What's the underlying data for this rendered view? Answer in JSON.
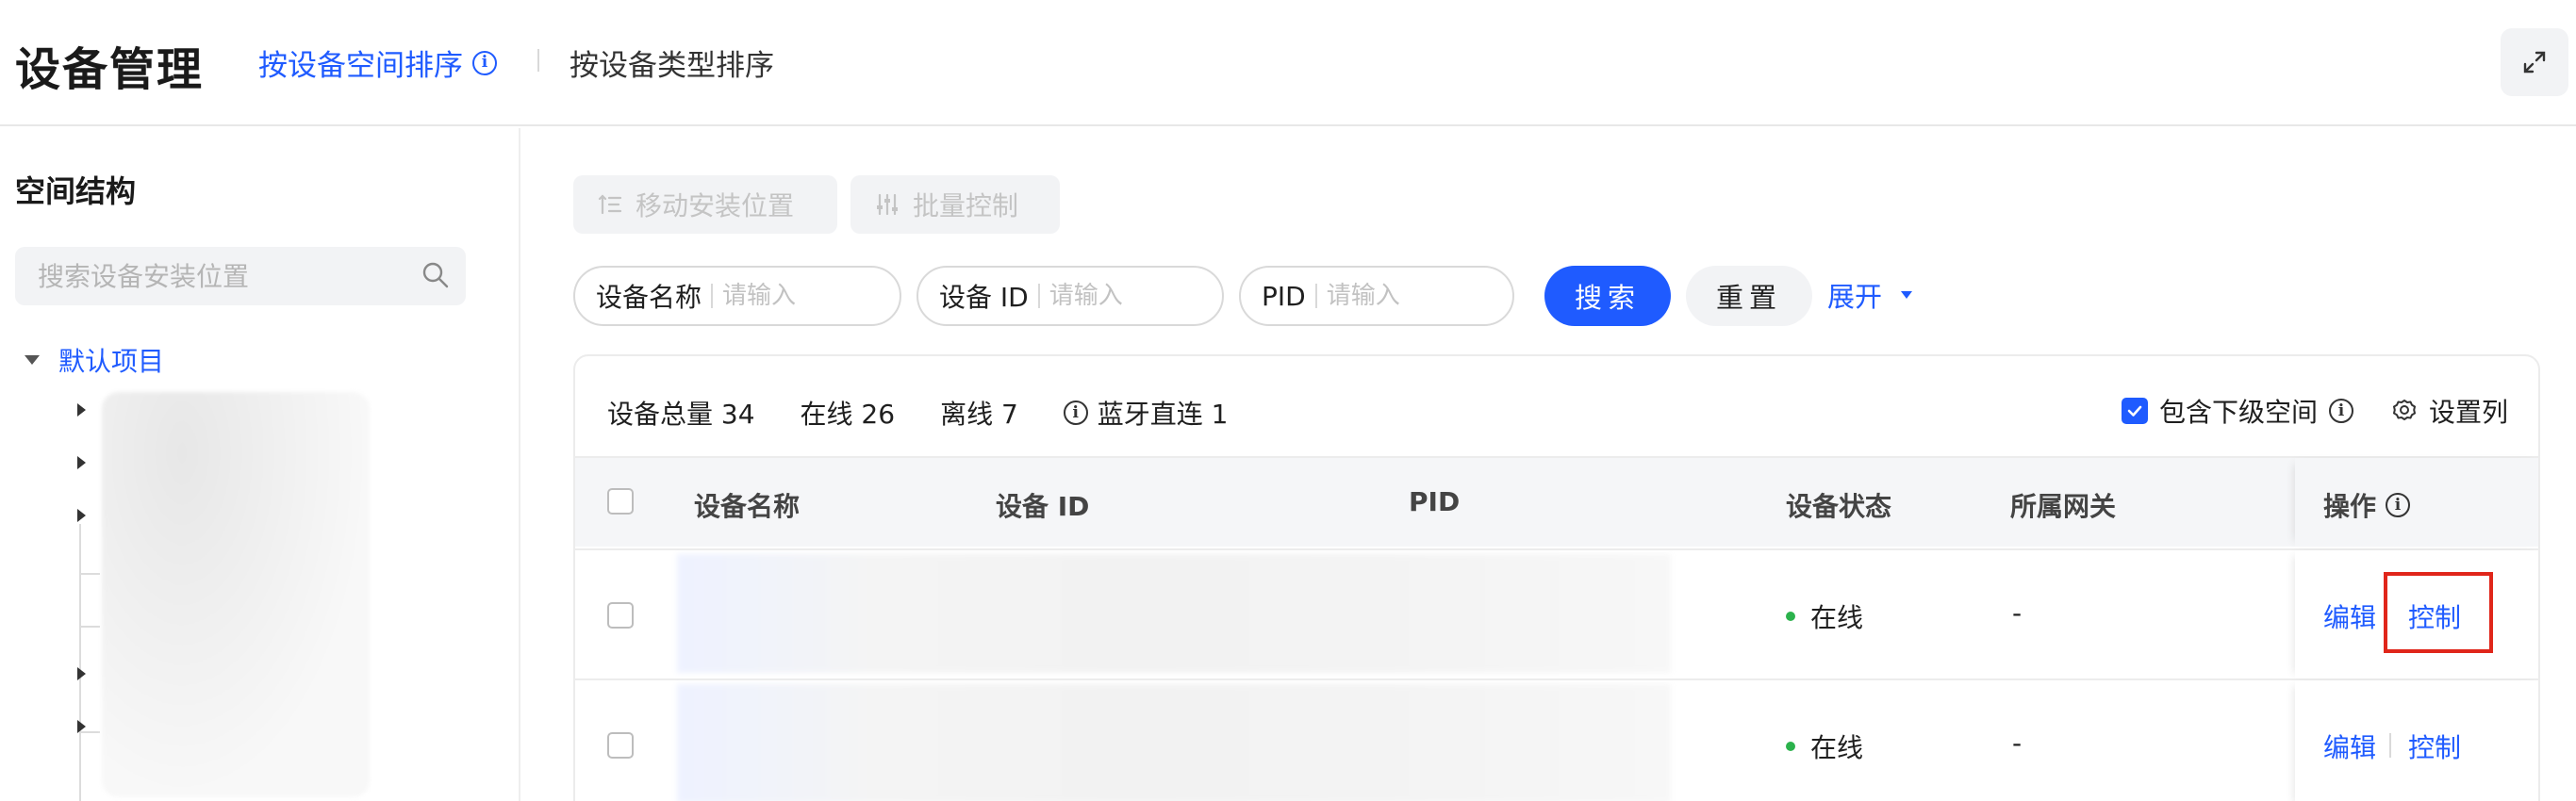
{
  "header": {
    "title": "设备管理",
    "tab_active": "按设备空间排序",
    "tab_inactive": "按设备类型排序",
    "expand_icon": "expand-icon"
  },
  "sidebar": {
    "title": "空间结构",
    "search_placeholder": "搜索设备安装位置",
    "tree_root_label": "默认项目"
  },
  "toolbar": {
    "move_label": "移动安装位置",
    "batch_label": "批量控制"
  },
  "filters": {
    "name_label": "设备名称",
    "id_label": "设备 ID",
    "pid_label": "PID",
    "placeholder": "请输入",
    "search_btn": "搜索",
    "reset_btn": "重置",
    "expand_label": "展开"
  },
  "stats": {
    "total": "设备总量 34",
    "online": "在线 26",
    "offline": "离线 7",
    "ble": "蓝牙直连 1",
    "include_sub": "包含下级空间",
    "include_sub_checked": true,
    "set_columns": "设置列"
  },
  "table": {
    "columns": [
      "设备名称",
      "设备 ID",
      "PID",
      "设备状态",
      "所属网关",
      "操作"
    ],
    "rows": [
      {
        "status": "在线",
        "gateway": "-",
        "edit": "编辑",
        "control": "控制"
      },
      {
        "status": "在线",
        "gateway": "-",
        "edit": "编辑",
        "control": "控制"
      }
    ]
  },
  "colors": {
    "accent": "#1f5bff",
    "online": "#2bb24c",
    "highlight": "#e0261a"
  }
}
